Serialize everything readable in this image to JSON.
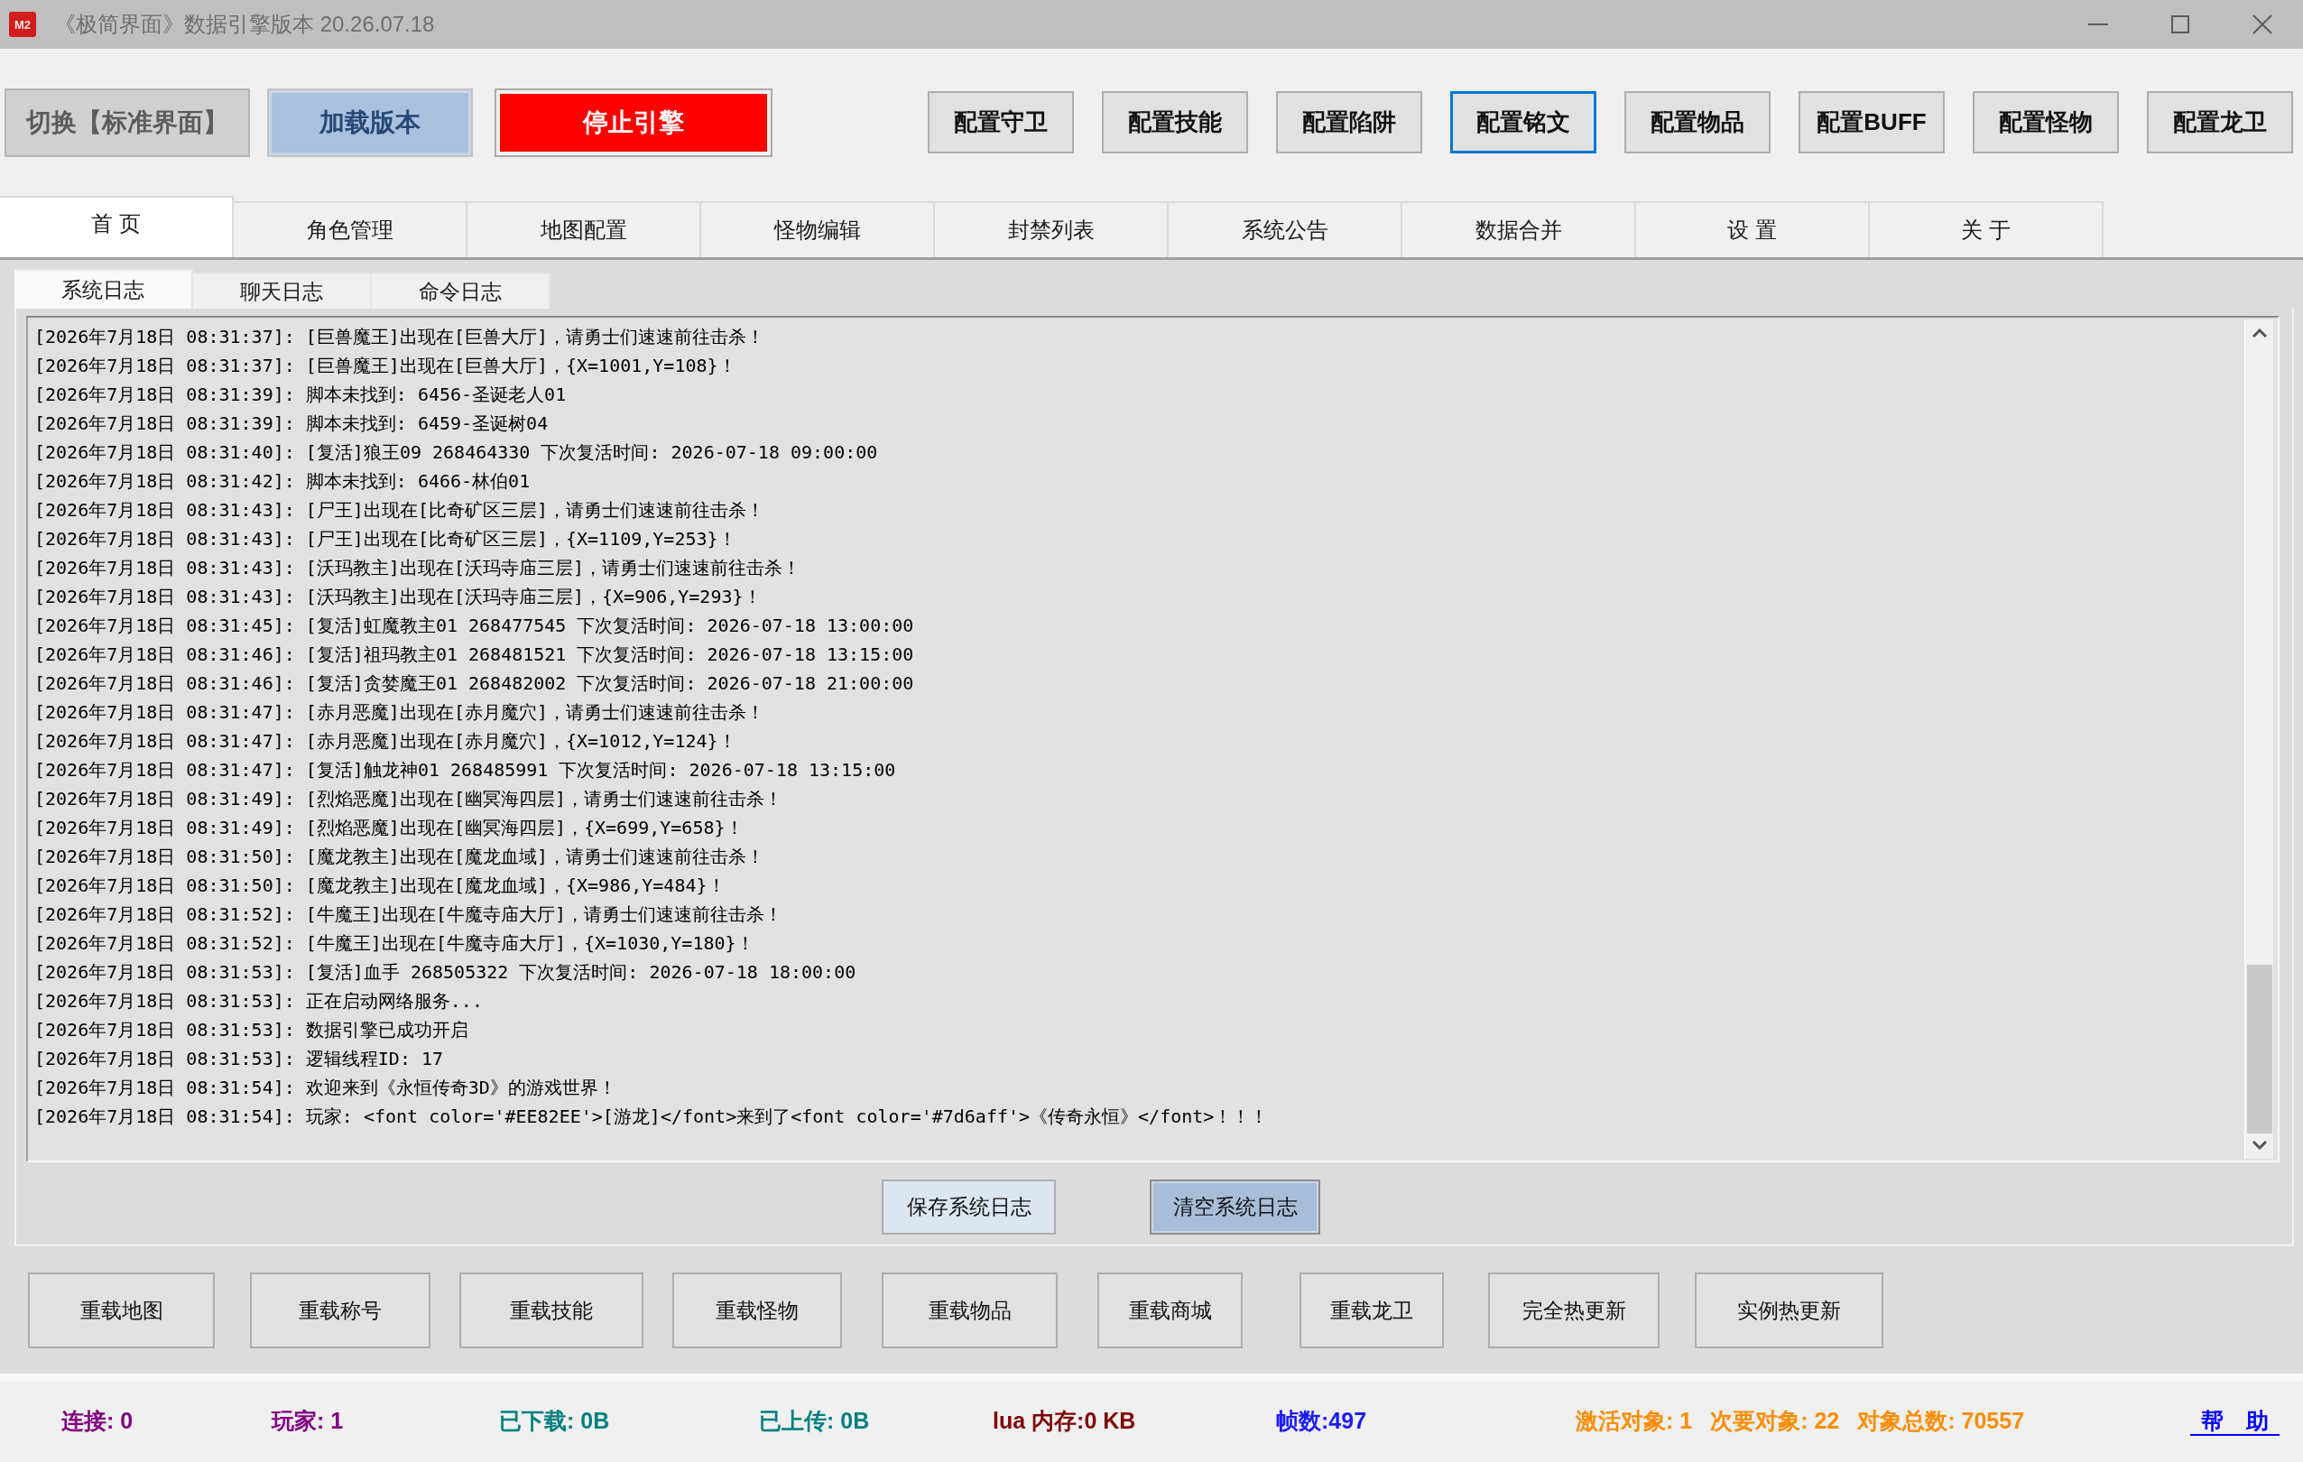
{
  "window": {
    "icon_label": "M2",
    "title": "《极简界面》数据引擎版本 20.26.07.18"
  },
  "toolbar": {
    "actions": [
      {
        "label": "切换【标准界面】",
        "kind": "neutral"
      },
      {
        "label": "加载版本",
        "kind": "primary"
      },
      {
        "label": "停止引擎",
        "kind": "danger"
      }
    ],
    "config_buttons": [
      {
        "label": "配置守卫",
        "focused": false
      },
      {
        "label": "配置技能",
        "focused": false
      },
      {
        "label": "配置陷阱",
        "focused": false
      },
      {
        "label": "配置铭文",
        "focused": true
      },
      {
        "label": "配置物品",
        "focused": false
      },
      {
        "label": "配置BUFF",
        "focused": false
      },
      {
        "label": "配置怪物",
        "focused": false
      },
      {
        "label": "配置龙卫",
        "focused": false
      }
    ]
  },
  "tabs": [
    {
      "label": "首 页",
      "selected": true
    },
    {
      "label": "角色管理",
      "selected": false
    },
    {
      "label": "地图配置",
      "selected": false
    },
    {
      "label": "怪物编辑",
      "selected": false
    },
    {
      "label": "封禁列表",
      "selected": false
    },
    {
      "label": "系统公告",
      "selected": false
    },
    {
      "label": "数据合并",
      "selected": false
    },
    {
      "label": "设 置",
      "selected": false
    },
    {
      "label": "关 于",
      "selected": false
    }
  ],
  "log_panel": {
    "tabs": [
      {
        "label": "系统日志",
        "selected": true
      },
      {
        "label": "聊天日志",
        "selected": false
      },
      {
        "label": "命令日志",
        "selected": false
      }
    ],
    "lines": [
      "[2026年7月18日 08:31:37]: [巨兽魔王]出现在[巨兽大厅]，请勇士们速速前往击杀！",
      "[2026年7月18日 08:31:37]: [巨兽魔王]出现在[巨兽大厅]，{X=1001,Y=108}！",
      "[2026年7月18日 08:31:39]: 脚本未找到: 6456-圣诞老人01",
      "[2026年7月18日 08:31:39]: 脚本未找到: 6459-圣诞树04",
      "[2026年7月18日 08:31:40]: [复活]狼王09 268464330 下次复活时间: 2026-07-18 09:00:00",
      "[2026年7月18日 08:31:42]: 脚本未找到: 6466-林伯01",
      "[2026年7月18日 08:31:43]: [尸王]出现在[比奇矿区三层]，请勇士们速速前往击杀！",
      "[2026年7月18日 08:31:43]: [尸王]出现在[比奇矿区三层]，{X=1109,Y=253}！",
      "[2026年7月18日 08:31:43]: [沃玛教主]出现在[沃玛寺庙三层]，请勇士们速速前往击杀！",
      "[2026年7月18日 08:31:43]: [沃玛教主]出现在[沃玛寺庙三层]，{X=906,Y=293}！",
      "[2026年7月18日 08:31:45]: [复活]虹魔教主01 268477545 下次复活时间: 2026-07-18 13:00:00",
      "[2026年7月18日 08:31:46]: [复活]祖玛教主01 268481521 下次复活时间: 2026-07-18 13:15:00",
      "[2026年7月18日 08:31:46]: [复活]贪婪魔王01 268482002 下次复活时间: 2026-07-18 21:00:00",
      "[2026年7月18日 08:31:47]: [赤月恶魔]出现在[赤月魔穴]，请勇士们速速前往击杀！",
      "[2026年7月18日 08:31:47]: [赤月恶魔]出现在[赤月魔穴]，{X=1012,Y=124}！",
      "[2026年7月18日 08:31:47]: [复活]触龙神01 268485991 下次复活时间: 2026-07-18 13:15:00",
      "[2026年7月18日 08:31:49]: [烈焰恶魔]出现在[幽冥海四层]，请勇士们速速前往击杀！",
      "[2026年7月18日 08:31:49]: [烈焰恶魔]出现在[幽冥海四层]，{X=699,Y=658}！",
      "[2026年7月18日 08:31:50]: [魔龙教主]出现在[魔龙血域]，请勇士们速速前往击杀！",
      "[2026年7月18日 08:31:50]: [魔龙教主]出现在[魔龙血域]，{X=986,Y=484}！",
      "[2026年7月18日 08:31:52]: [牛魔王]出现在[牛魔寺庙大厅]，请勇士们速速前往击杀！",
      "[2026年7月18日 08:31:52]: [牛魔王]出现在[牛魔寺庙大厅]，{X=1030,Y=180}！",
      "[2026年7月18日 08:31:53]: [复活]血手 268505322 下次复活时间: 2026-07-18 18:00:00",
      "[2026年7月18日 08:31:53]: 正在启动网络服务...",
      "[2026年7月18日 08:31:53]: 数据引擎已成功开启",
      "[2026年7月18日 08:31:53]: 逻辑线程ID: 17",
      "[2026年7月18日 08:31:54]: 欢迎来到《永恒传奇3D》的游戏世界！",
      "[2026年7月18日 08:31:54]: 玩家: <font color='#EE82EE'>[游龙]</font>来到了<font color='#7d6aff'>《传奇永恒》</font>！！！"
    ],
    "buttons": [
      {
        "label": "保存系统日志",
        "highlighted": false
      },
      {
        "label": "清空系统日志",
        "highlighted": true
      }
    ]
  },
  "reload_buttons": [
    "重载地图",
    "重载称号",
    "重载技能",
    "重载怪物",
    "重载物品",
    "重载商城",
    "重载龙卫",
    "完全热更新",
    "实例热更新"
  ],
  "status_bar": {
    "items": [
      {
        "text": "连接: 0",
        "color": "#800080"
      },
      {
        "text": "玩家: 1",
        "color": "#800080"
      },
      {
        "text": "已下载: 0B",
        "color": "#008080"
      },
      {
        "text": "已上传: 0B",
        "color": "#008080"
      },
      {
        "text": "lua 内存:0 KB",
        "color": "#800000"
      },
      {
        "text": "帧数:497",
        "color": "#1a1aff"
      },
      {
        "text": "激活对象: 1",
        "color": "#ff8c00"
      },
      {
        "text": "次要对象: 22",
        "color": "#ff8c00"
      },
      {
        "text": "对象总数: 70557",
        "color": "#ff8c00"
      }
    ],
    "help_link": "帮　助"
  }
}
